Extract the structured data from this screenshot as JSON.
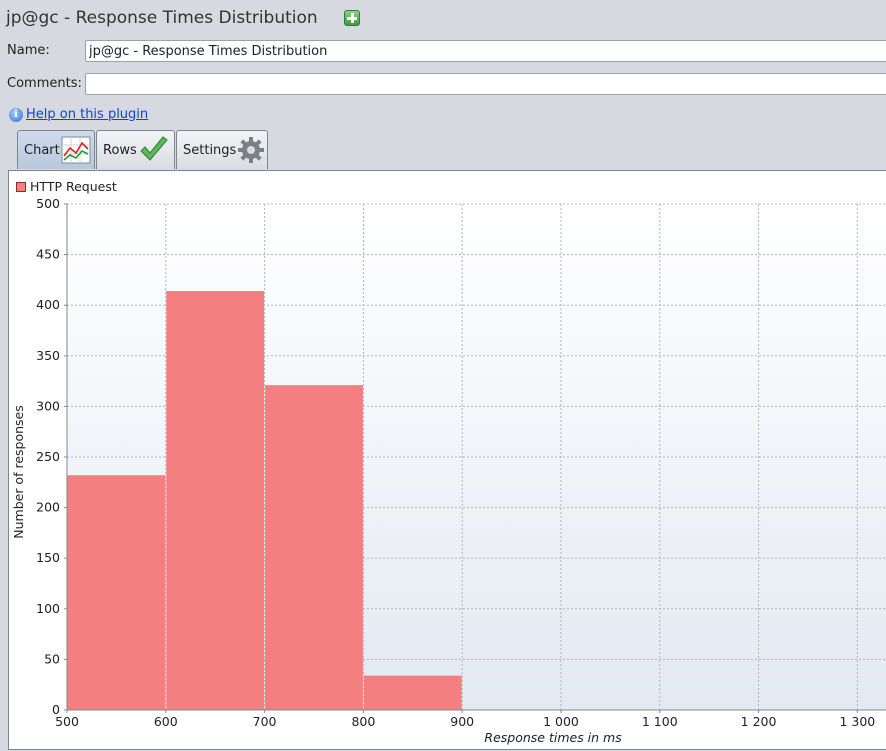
{
  "window": {
    "title": "jp@gc - Response Times Distribution",
    "title_icon": "add-green-icon"
  },
  "form": {
    "name_label": "Name:",
    "name_value": "jp@gc - Response Times Distribution",
    "comments_label": "Comments:",
    "comments_value": ""
  },
  "help": {
    "icon": "info-icon",
    "link_text": "Help on this plugin"
  },
  "tabs": [
    {
      "label": "Chart",
      "icon": "line-chart-icon",
      "active": true
    },
    {
      "label": "Rows",
      "icon": "checkmark-icon",
      "active": false
    },
    {
      "label": "Settings",
      "icon": "gear-icon",
      "active": false
    }
  ],
  "colors": {
    "bar": "#f47f80",
    "plot_background_top": "#ffffff",
    "plot_background_bottom": "#e3e9f2",
    "grid": "#b3b3b3"
  },
  "chart_data": {
    "type": "bar",
    "title": "",
    "xlabel": "Response times in ms",
    "ylabel": "Number of responses",
    "xlim": [
      500,
      1330
    ],
    "ylim": [
      0,
      500
    ],
    "x_ticks": [
      500,
      600,
      700,
      800,
      900,
      1000,
      1100,
      1200,
      1300
    ],
    "x_tick_labels": [
      "500",
      "600",
      "700",
      "800",
      "900",
      "1 000",
      "1 100",
      "1 200",
      "1 300"
    ],
    "y_ticks": [
      0,
      50,
      100,
      150,
      200,
      250,
      300,
      350,
      400,
      450,
      500
    ],
    "y_tick_labels": [
      "0",
      "50",
      "100",
      "150",
      "200",
      "250",
      "300",
      "350",
      "400",
      "450",
      "500"
    ],
    "grid": true,
    "legend_position": "top-left",
    "series": [
      {
        "name": "HTTP Request",
        "bins": [
          {
            "x0": 500,
            "x1": 600,
            "value": 232
          },
          {
            "x0": 600,
            "x1": 700,
            "value": 414
          },
          {
            "x0": 700,
            "x1": 800,
            "value": 321
          },
          {
            "x0": 800,
            "x1": 900,
            "value": 34
          }
        ]
      }
    ]
  }
}
